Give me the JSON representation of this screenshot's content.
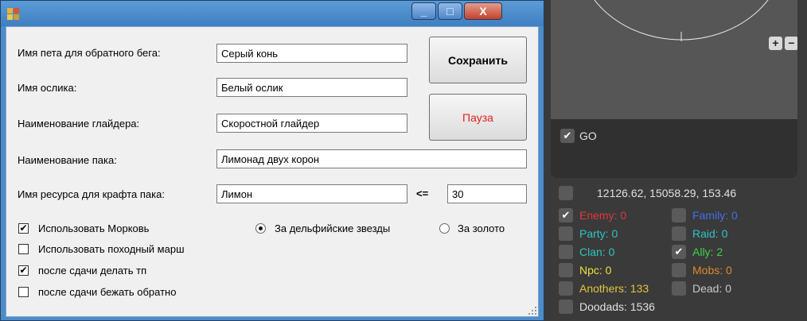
{
  "window": {
    "controls": {
      "minimize": "_",
      "maximize": "□",
      "close": "X"
    },
    "fields": {
      "pet_label": "Имя пета для обратного бега:",
      "pet_value": "Серый конь",
      "donkey_label": "Имя ослика:",
      "donkey_value": "Белый ослик",
      "glider_label": "Наименование глайдера:",
      "glider_value": "Скоростной глайдер",
      "pack_label": "Наименование пака:",
      "pack_value": "Лимонад двух корон",
      "resource_label": "Имя ресурса для крафта пака:",
      "resource_value": "Лимон",
      "compare_symbol": "<=",
      "threshold_value": "30"
    },
    "buttons": {
      "save": "Сохранить",
      "pause": "Пауза"
    },
    "checkboxes": [
      {
        "label": "Использовать Морковь",
        "checked": true
      },
      {
        "label": "Использовать походный марш",
        "checked": false
      },
      {
        "label": "после сдачи делать тп",
        "checked": true
      },
      {
        "label": "после сдачи бежать обратно",
        "checked": false
      }
    ],
    "radios": [
      {
        "label": "За дельфийские звезды",
        "selected": true
      },
      {
        "label": "За золото",
        "selected": false
      }
    ]
  },
  "panel": {
    "zoom_in": "+",
    "zoom_out": "−",
    "go_label": "GO",
    "go_checked": true,
    "coordinates": "12126.62, 15058.29, 153.46",
    "filters_left": [
      {
        "label": "Enemy: 0",
        "checked": true,
        "color": "#e0383b"
      },
      {
        "label": "Party: 0",
        "checked": false,
        "color": "#2ec4c4"
      },
      {
        "label": "Clan: 0",
        "checked": false,
        "color": "#2ec4c4"
      },
      {
        "label": "Npc: 0",
        "checked": false,
        "color": "#e9e23a"
      },
      {
        "label": "Anothers: 133",
        "checked": false,
        "color": "#e3c43c"
      },
      {
        "label": "Doodads: 1536",
        "checked": false,
        "color": "#e0e0e0"
      }
    ],
    "filters_right": [
      {
        "label": "Family: 0",
        "checked": false,
        "color": "#4070e8"
      },
      {
        "label": "Raid: 0",
        "checked": false,
        "color": "#2ec4c4"
      },
      {
        "label": "Ally: 2",
        "checked": true,
        "color": "#3fd14b"
      },
      {
        "label": "Mobs: 0",
        "checked": false,
        "color": "#e0892e"
      },
      {
        "label": "Dead: 0",
        "checked": false,
        "color": "#c8c8c8"
      }
    ],
    "checkmark": "✔"
  }
}
